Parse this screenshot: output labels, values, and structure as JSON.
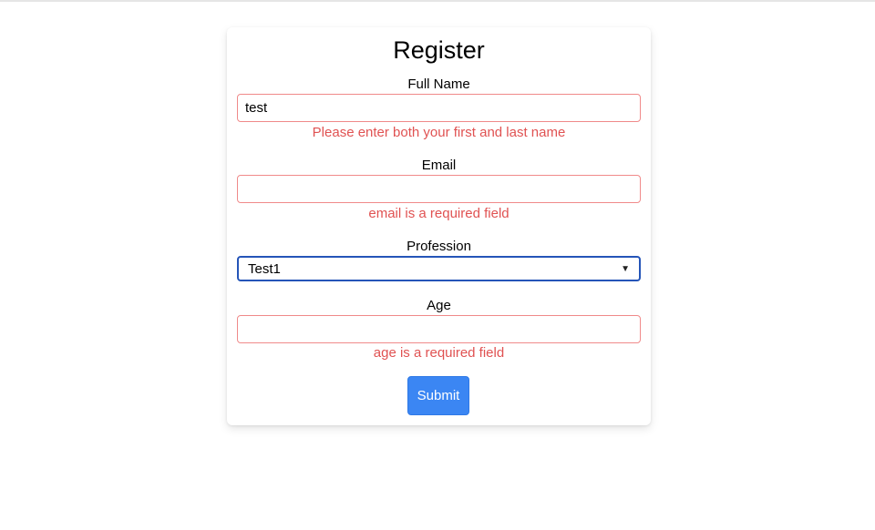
{
  "form": {
    "title": "Register",
    "full_name": {
      "label": "Full Name",
      "value": "test",
      "error": "Please enter both your first and last name"
    },
    "email": {
      "label": "Email",
      "value": "",
      "error": "email is a required field"
    },
    "profession": {
      "label": "Profession",
      "selected": "Test1"
    },
    "age": {
      "label": "Age",
      "value": "",
      "error": "age is a required field"
    },
    "submit_label": "Submit"
  },
  "colors": {
    "error": "#e05252",
    "error_border": "#f08a8a",
    "focus_border": "#2555b8",
    "button": "#3b86f3"
  },
  "icons": {
    "select_arrow": "chevron-down-icon"
  }
}
